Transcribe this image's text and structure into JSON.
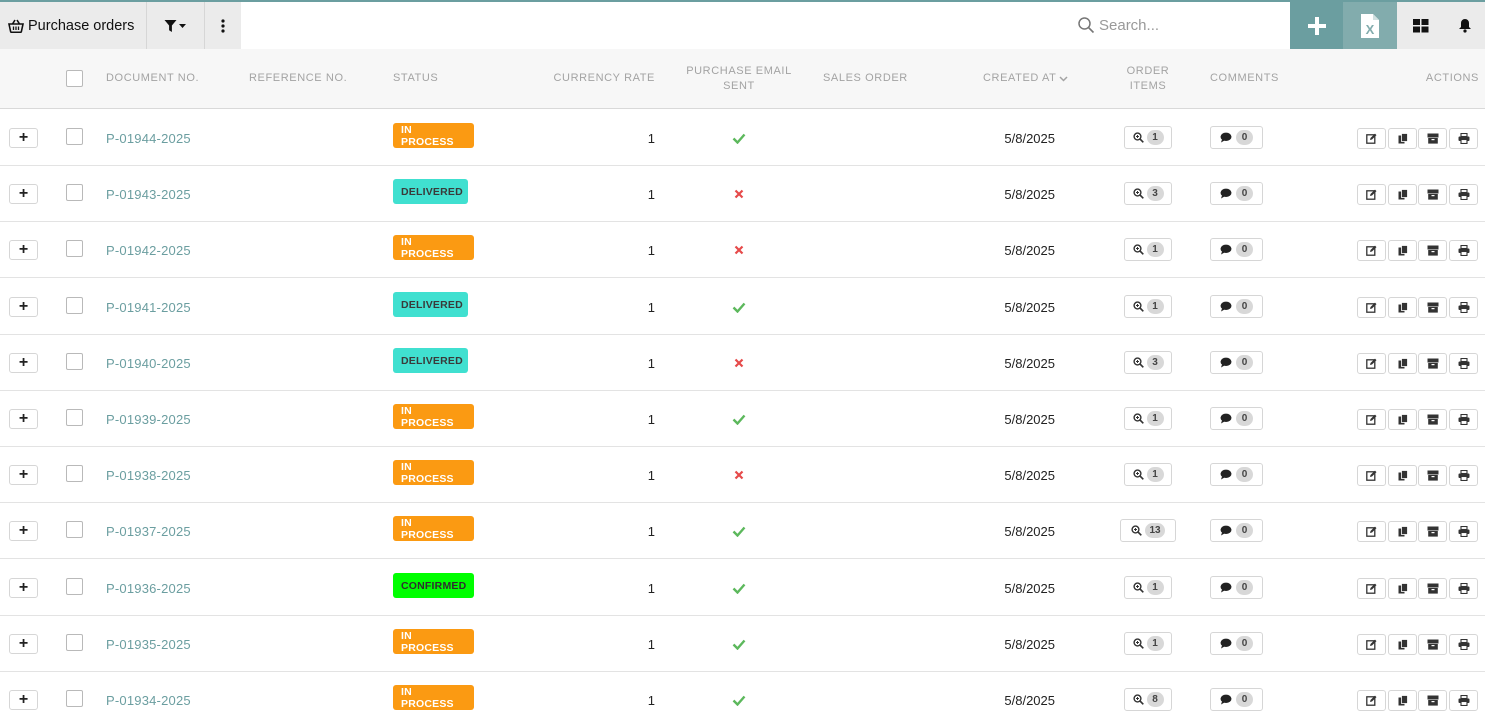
{
  "toolbar": {
    "title": "Purchase orders",
    "search_placeholder": "Search...",
    "icons": {
      "title": "basket-icon",
      "filter": "filter-icon",
      "more": "more-vertical-icon",
      "search": "search-icon",
      "add": "plus-icon",
      "excel": "excel-export-icon",
      "grid": "grid-view-icon",
      "bell": "bell-icon"
    }
  },
  "colors": {
    "accent": "#6b9ea0",
    "in_process": "#fb9a12",
    "delivered": "#40e0d0",
    "confirmed": "#00ff00",
    "check": "#5cb85c",
    "cross": "#e64a4a"
  },
  "columns": {
    "document_no": "DOCUMENT NO.",
    "reference_no": "REFERENCE NO.",
    "status": "STATUS",
    "currency_rate": "CURRENCY RATE",
    "purchase_email_sent_line1": "PURCHASE EMAIL",
    "purchase_email_sent_line2": "SENT",
    "sales_order": "SALES ORDER",
    "created_at": "CREATED AT",
    "order_items_line1": "ORDER",
    "order_items_line2": "ITEMS",
    "comments": "COMMENTS",
    "actions": "ACTIONS"
  },
  "rows": [
    {
      "expand": "+",
      "doc_no": "P-01944-2025",
      "reference_no": "",
      "status": "IN PROCESS",
      "status_key": "in_process",
      "currency_rate": "1",
      "email_sent": true,
      "sales_order": "",
      "created_at": "5/8/2025",
      "order_items": "1",
      "comments": "0"
    },
    {
      "expand": "+",
      "doc_no": "P-01943-2025",
      "reference_no": "",
      "status": "DELIVERED",
      "status_key": "delivered",
      "currency_rate": "1",
      "email_sent": false,
      "sales_order": "",
      "created_at": "5/8/2025",
      "order_items": "3",
      "comments": "0"
    },
    {
      "expand": "+",
      "doc_no": "P-01942-2025",
      "reference_no": "",
      "status": "IN PROCESS",
      "status_key": "in_process",
      "currency_rate": "1",
      "email_sent": false,
      "sales_order": "",
      "created_at": "5/8/2025",
      "order_items": "1",
      "comments": "0"
    },
    {
      "expand": "+",
      "doc_no": "P-01941-2025",
      "reference_no": "",
      "status": "DELIVERED",
      "status_key": "delivered",
      "currency_rate": "1",
      "email_sent": true,
      "sales_order": "",
      "created_at": "5/8/2025",
      "order_items": "1",
      "comments": "0"
    },
    {
      "expand": "+",
      "doc_no": "P-01940-2025",
      "reference_no": "",
      "status": "DELIVERED",
      "status_key": "delivered",
      "currency_rate": "1",
      "email_sent": false,
      "sales_order": "",
      "created_at": "5/8/2025",
      "order_items": "3",
      "comments": "0"
    },
    {
      "expand": "+",
      "doc_no": "P-01939-2025",
      "reference_no": "",
      "status": "IN PROCESS",
      "status_key": "in_process",
      "currency_rate": "1",
      "email_sent": true,
      "sales_order": "",
      "created_at": "5/8/2025",
      "order_items": "1",
      "comments": "0"
    },
    {
      "expand": "+",
      "doc_no": "P-01938-2025",
      "reference_no": "",
      "status": "IN PROCESS",
      "status_key": "in_process",
      "currency_rate": "1",
      "email_sent": false,
      "sales_order": "",
      "created_at": "5/8/2025",
      "order_items": "1",
      "comments": "0"
    },
    {
      "expand": "+",
      "doc_no": "P-01937-2025",
      "reference_no": "",
      "status": "IN PROCESS",
      "status_key": "in_process",
      "currency_rate": "1",
      "email_sent": true,
      "sales_order": "",
      "created_at": "5/8/2025",
      "order_items": "13",
      "comments": "0"
    },
    {
      "expand": "+",
      "doc_no": "P-01936-2025",
      "reference_no": "",
      "status": "CONFIRMED",
      "status_key": "confirmed",
      "currency_rate": "1",
      "email_sent": true,
      "sales_order": "",
      "created_at": "5/8/2025",
      "order_items": "1",
      "comments": "0"
    },
    {
      "expand": "+",
      "doc_no": "P-01935-2025",
      "reference_no": "",
      "status": "IN PROCESS",
      "status_key": "in_process",
      "currency_rate": "1",
      "email_sent": true,
      "sales_order": "",
      "created_at": "5/8/2025",
      "order_items": "1",
      "comments": "0"
    },
    {
      "expand": "+",
      "doc_no": "P-01934-2025",
      "reference_no": "",
      "status": "IN PROCESS",
      "status_key": "in_process",
      "currency_rate": "1",
      "email_sent": true,
      "sales_order": "",
      "created_at": "5/8/2025",
      "order_items": "8",
      "comments": "0"
    }
  ],
  "row_actions": [
    "edit-icon",
    "copy-icon",
    "archive-icon",
    "print-icon"
  ]
}
